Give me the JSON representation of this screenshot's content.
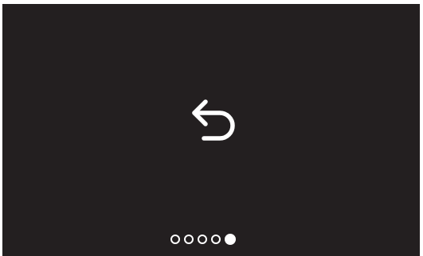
{
  "screen": {
    "background_color": "#231f20",
    "foreground_color": "#ffffff"
  },
  "back_button": {
    "icon": "undo-arrow-icon"
  },
  "pager": {
    "total_pages": 5,
    "active_page": 5
  }
}
